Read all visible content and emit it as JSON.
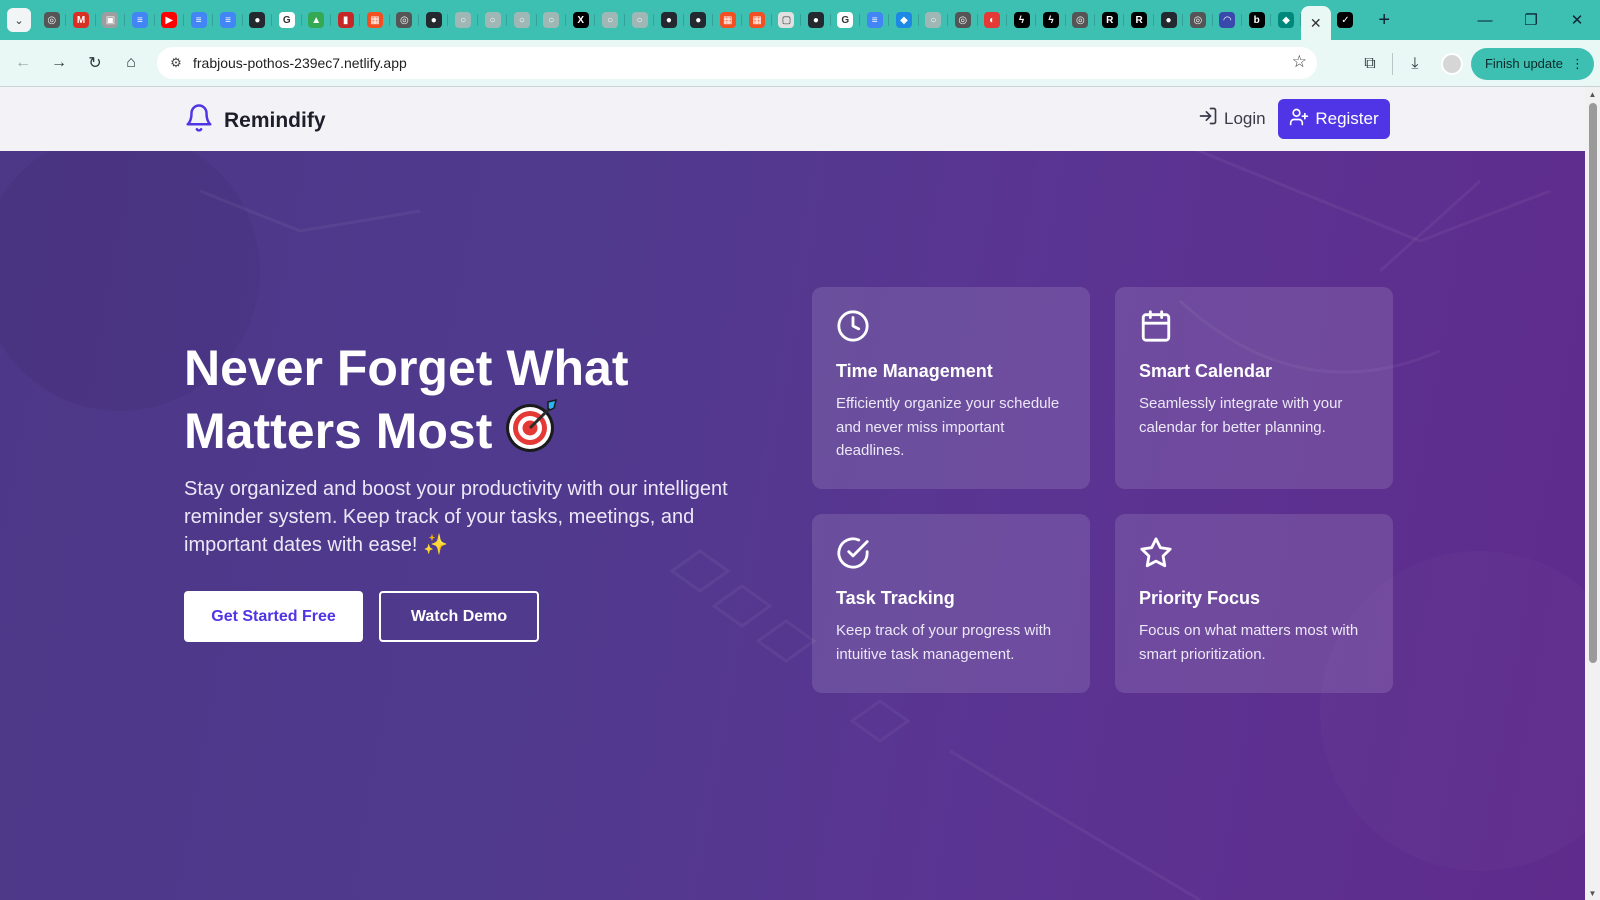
{
  "browser": {
    "url": "frabjous-pothos-239ec7.netlify.app",
    "finish_update_label": "Finish update",
    "tab_favicons": [
      {
        "icon": "openai-icon",
        "color": "#555555",
        "glyph": "◎"
      },
      {
        "icon": "gmail-icon",
        "color": "#d93025",
        "glyph": "M"
      },
      {
        "icon": "app-icon",
        "color": "#9e9e9e",
        "glyph": "▣"
      },
      {
        "icon": "docs-icon",
        "color": "#4285f4",
        "glyph": "≡"
      },
      {
        "icon": "youtube-icon",
        "color": "#ff0000",
        "glyph": "▶"
      },
      {
        "icon": "docs-icon",
        "color": "#4285f4",
        "glyph": "≡"
      },
      {
        "icon": "docs-icon",
        "color": "#4285f4",
        "glyph": "≡"
      },
      {
        "icon": "github-icon",
        "color": "#24292f",
        "glyph": "●"
      },
      {
        "icon": "google-icon",
        "color": "#ffffff",
        "glyph": "G"
      },
      {
        "icon": "drive-icon",
        "color": "#34a853",
        "glyph": "▲"
      },
      {
        "icon": "app-icon",
        "color": "#c62828",
        "glyph": "▮"
      },
      {
        "icon": "microsoft-icon",
        "color": "#f25022",
        "glyph": "▦"
      },
      {
        "icon": "openai-icon",
        "color": "#555555",
        "glyph": "◎"
      },
      {
        "icon": "github-icon",
        "color": "#24292f",
        "glyph": "●"
      },
      {
        "icon": "blank-icon",
        "color": "#9fb8b5",
        "glyph": "○"
      },
      {
        "icon": "blank-icon",
        "color": "#9fb8b5",
        "glyph": "○"
      },
      {
        "icon": "blank-icon",
        "color": "#9fb8b5",
        "glyph": "○"
      },
      {
        "icon": "blank-icon",
        "color": "#9fb8b5",
        "glyph": "○"
      },
      {
        "icon": "x-icon",
        "color": "#000000",
        "glyph": "X"
      },
      {
        "icon": "blank-icon",
        "color": "#9fb8b5",
        "glyph": "○"
      },
      {
        "icon": "blank-icon",
        "color": "#9fb8b5",
        "glyph": "○"
      },
      {
        "icon": "github-icon",
        "color": "#24292f",
        "glyph": "●"
      },
      {
        "icon": "github-icon",
        "color": "#24292f",
        "glyph": "●"
      },
      {
        "icon": "microsoft-icon",
        "color": "#f25022",
        "glyph": "▦"
      },
      {
        "icon": "microsoft-icon",
        "color": "#f25022",
        "glyph": "▦"
      },
      {
        "icon": "app-icon",
        "color": "#e0e0e0",
        "glyph": "▢"
      },
      {
        "icon": "github-icon",
        "color": "#24292f",
        "glyph": "●"
      },
      {
        "icon": "google-icon",
        "color": "#ffffff",
        "glyph": "G"
      },
      {
        "icon": "docs-icon",
        "color": "#4285f4",
        "glyph": "≡"
      },
      {
        "icon": "app-icon",
        "color": "#1e88e5",
        "glyph": "◆"
      },
      {
        "icon": "blank-icon",
        "color": "#9fb8b5",
        "glyph": "○"
      },
      {
        "icon": "openai-icon",
        "color": "#555555",
        "glyph": "◎"
      },
      {
        "icon": "app-icon",
        "color": "#e53935",
        "glyph": "◐"
      },
      {
        "icon": "app-icon",
        "color": "#000000",
        "glyph": "ϟ"
      },
      {
        "icon": "app-icon",
        "color": "#000000",
        "glyph": "ϟ"
      },
      {
        "icon": "openai-icon",
        "color": "#555555",
        "glyph": "◎"
      },
      {
        "icon": "app-icon",
        "color": "#000000",
        "glyph": "R"
      },
      {
        "icon": "app-icon",
        "color": "#000000",
        "glyph": "R"
      },
      {
        "icon": "github-icon",
        "color": "#24292f",
        "glyph": "●"
      },
      {
        "icon": "openai-icon",
        "color": "#555555",
        "glyph": "◎"
      },
      {
        "icon": "app-icon",
        "color": "#3949ab",
        "glyph": "◠"
      },
      {
        "icon": "app-icon",
        "color": "#000000",
        "glyph": "b"
      },
      {
        "icon": "app-icon",
        "color": "#00897b",
        "glyph": "◆"
      }
    ],
    "active_tab_close": "✕",
    "last_tab_favicon": {
      "icon": "app-icon",
      "color": "#000000",
      "glyph": "✓"
    }
  },
  "site": {
    "brand": "Remindify",
    "login_label": "Login",
    "register_label": "Register",
    "accent_color": "#4f35e6"
  },
  "hero": {
    "title_line1": "Never Forget What",
    "title_line2": "Matters Most",
    "title_emoji": "🎯",
    "subtitle": "Stay organized and boost your productivity with our intelligent reminder system. Keep track of your tasks, meetings, and important dates with ease! ✨",
    "primary_cta": "Get Started Free",
    "secondary_cta": "Watch Demo"
  },
  "features": [
    {
      "icon": "clock-icon",
      "title": "Time Management",
      "description": "Efficiently organize your schedule and never miss important deadlines."
    },
    {
      "icon": "calendar-icon",
      "title": "Smart Calendar",
      "description": "Seamlessly integrate with your calendar for better planning."
    },
    {
      "icon": "check-circle-icon",
      "title": "Task Tracking",
      "description": "Keep track of your progress with intuitive task management."
    },
    {
      "icon": "star-icon",
      "title": "Priority Focus",
      "description": "Focus on what matters most with smart prioritization."
    }
  ]
}
